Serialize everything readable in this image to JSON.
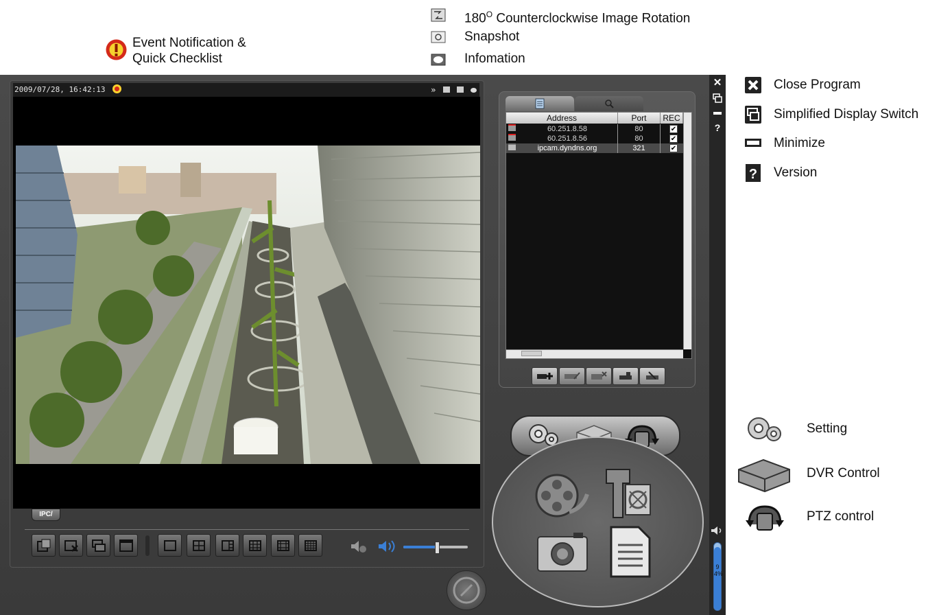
{
  "annotations": {
    "event_notification": "Event Notification &",
    "quick_checklist": "Quick Checklist",
    "rotation_prefix": "180",
    "rotation_sup": "O",
    "rotation_suffix": " Counterclockwise Image Rotation",
    "snapshot": "Snapshot",
    "information": "Infomation",
    "close_program": "Close Program",
    "simplified_display": "Simplified Display Switch",
    "minimize": "Minimize",
    "version": "Version",
    "setting": "Setting",
    "dvr_control": "DVR Control",
    "ptz_control": "PTZ control"
  },
  "video": {
    "timestamp": "2009/07/28, 16:42:13",
    "channel_tab": "IPC/"
  },
  "device_list": {
    "columns": [
      "Address",
      "Port",
      "REC"
    ],
    "rows": [
      {
        "address": "60.251.8.58",
        "port": "80",
        "rec": "✔"
      },
      {
        "address": "60.251.8.56",
        "port": "80",
        "rec": "✔"
      },
      {
        "address": "ipcam.dyndns.org",
        "port": "321",
        "rec": "✔"
      }
    ]
  },
  "volume": {
    "percent_label": "94%",
    "level": 0.94
  },
  "colors": {
    "accent_blue": "#3a7fd6",
    "alert_red": "#d42a1a",
    "alert_yellow": "#f5d22e"
  }
}
